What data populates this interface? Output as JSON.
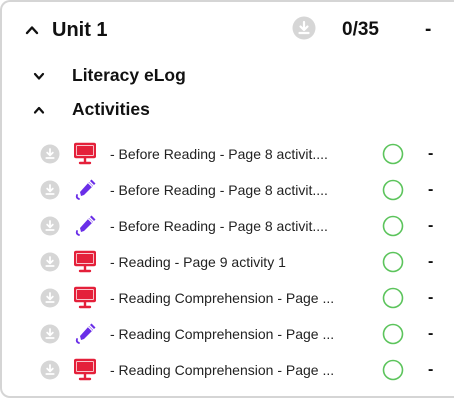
{
  "unit": {
    "title": "Unit 1",
    "count": "0/35",
    "dash": "-",
    "chevron_icon": "chevron-up-icon",
    "download_icon": "download-icon"
  },
  "sections": [
    {
      "title": "Literacy eLog",
      "chevron_icon": "chevron-down-icon"
    },
    {
      "title": "Activities",
      "chevron_icon": "chevron-up-icon"
    }
  ],
  "colors": {
    "presentation": "#e4203a",
    "edit": "#6a2ee8",
    "status": "#5cc45c",
    "download": "#d6d6d6"
  },
  "activities": [
    {
      "label": "- Before Reading - Page 8 activit....",
      "type_icon": "presentation-icon",
      "dash": "-"
    },
    {
      "label": "- Before Reading - Page 8 activit....",
      "type_icon": "pencil-icon",
      "dash": "-"
    },
    {
      "label": "- Before Reading - Page 8 activit....",
      "type_icon": "pencil-icon",
      "dash": "-"
    },
    {
      "label": "- Reading - Page 9 activity 1",
      "type_icon": "presentation-icon",
      "dash": "-"
    },
    {
      "label": "- Reading Comprehension - Page ...",
      "type_icon": "presentation-icon",
      "dash": "-"
    },
    {
      "label": "- Reading Comprehension - Page ...",
      "type_icon": "pencil-icon",
      "dash": "-"
    },
    {
      "label": "- Reading Comprehension - Page ...",
      "type_icon": "presentation-icon",
      "dash": "-"
    }
  ]
}
